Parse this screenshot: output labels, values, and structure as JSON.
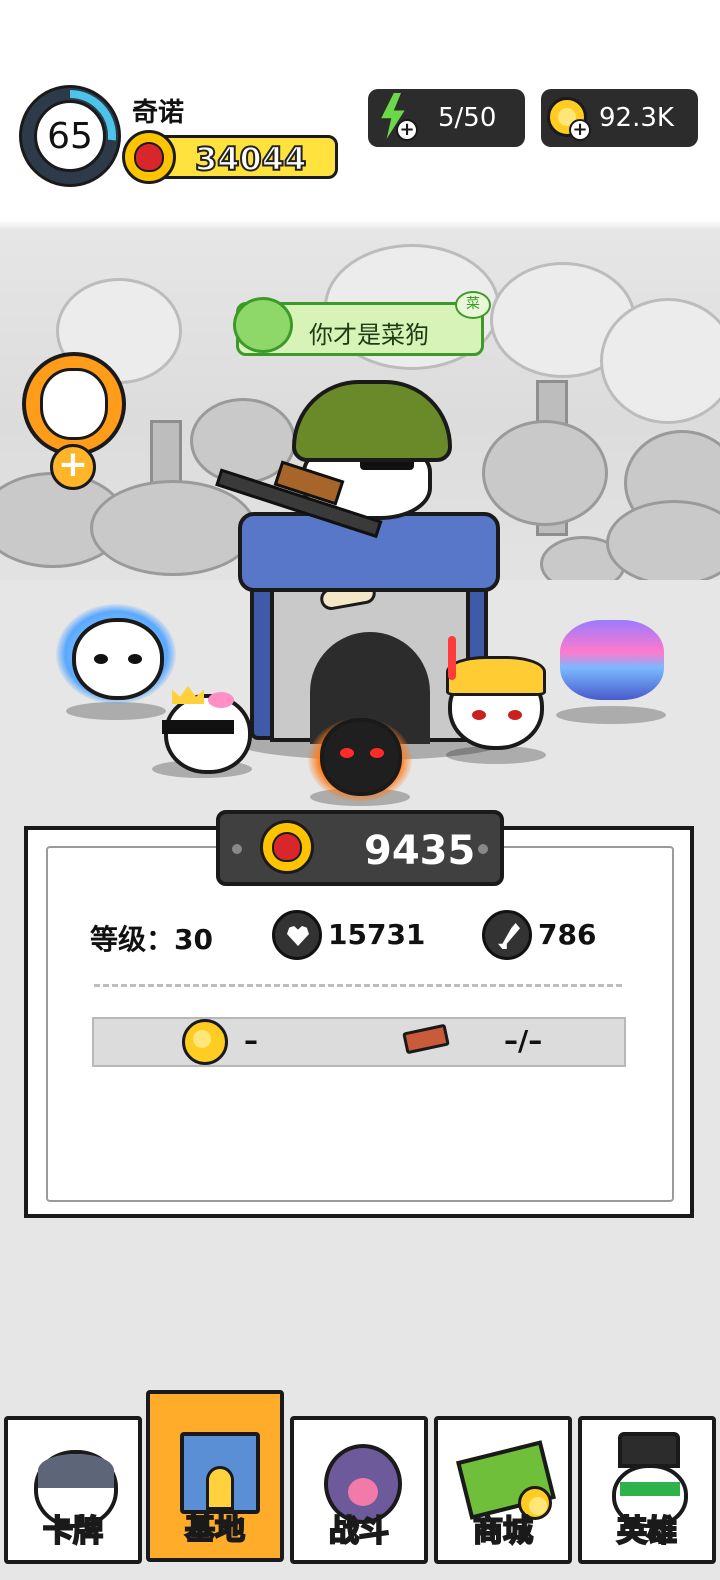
{
  "hud": {
    "player_level": "65",
    "player_name": "奇诺",
    "power_value": "34044",
    "energy_value": "5/50",
    "coins_value": "92.3K"
  },
  "scene": {
    "speech_bubble": "你才是菜狗",
    "speech_badge": "菜"
  },
  "panel": {
    "power_value": "9435",
    "level_text": "等级：30",
    "hp_value": "15731",
    "attack_value": "786",
    "upgrade_coin_cost": "–",
    "upgrade_brick_cost": "–/–"
  },
  "nav": {
    "tabs": [
      {
        "label": "卡牌"
      },
      {
        "label": "基地"
      },
      {
        "label": "战斗"
      },
      {
        "label": "商城"
      },
      {
        "label": "英雄"
      }
    ],
    "active_tab": "基地"
  },
  "colors": {
    "accent_orange": "#ffac2a",
    "power_yellow": "#ffe23d",
    "energy_green": "#6bd84b",
    "dark_panel": "#404040"
  },
  "icons": [
    "level-ring-icon",
    "boxing-glove-icon",
    "lightning-icon",
    "coin-icon",
    "plus-icon",
    "heart-icon",
    "sword-icon",
    "brick-icon"
  ]
}
